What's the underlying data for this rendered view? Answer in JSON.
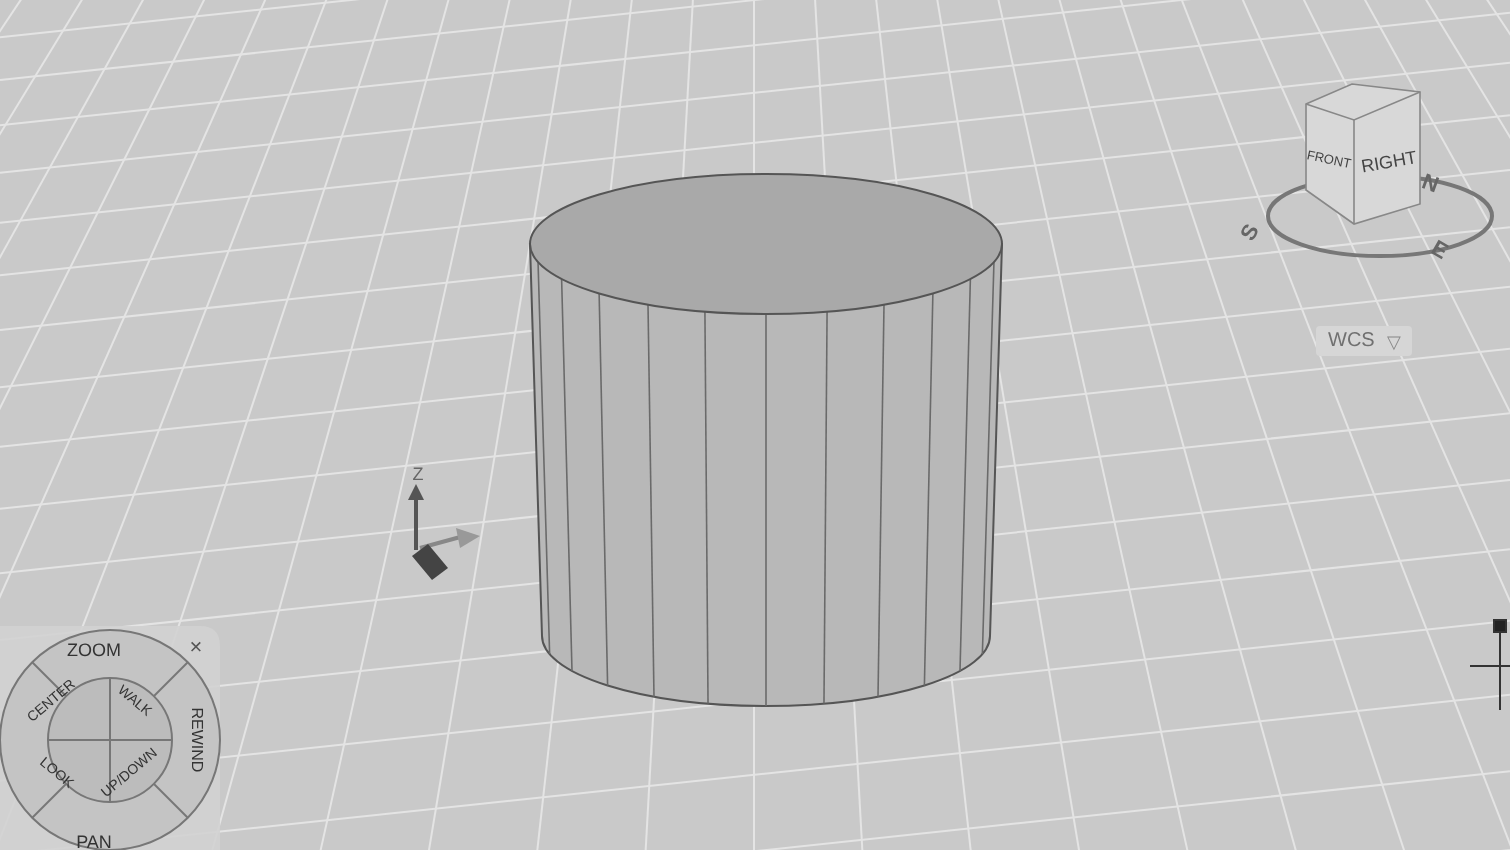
{
  "viewport": {
    "view_cube": {
      "faces": [
        "FRONT",
        "RIGHT"
      ],
      "compass": [
        "S",
        "E",
        "N"
      ]
    },
    "coordinate_system": {
      "label": "WCS",
      "caret": "▽"
    },
    "ucs_icon": {
      "axis_label": "Z"
    },
    "steering_wheel": {
      "outer": [
        "ZOOM",
        "REWIND",
        "PAN"
      ],
      "inner": [
        "CENTER",
        "WALK",
        "LOOK",
        "UP/DOWN"
      ],
      "close": "×"
    }
  }
}
